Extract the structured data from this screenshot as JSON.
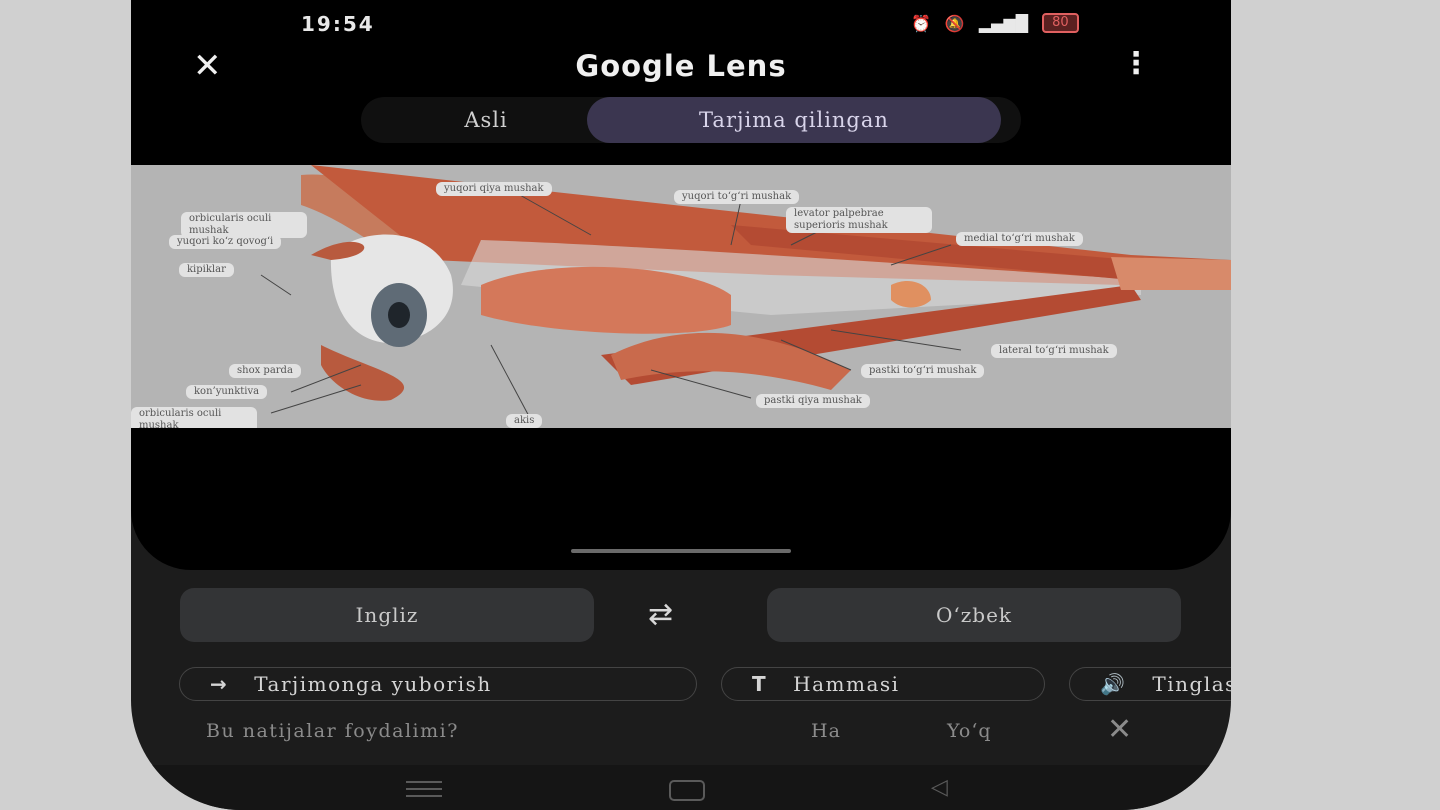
{
  "status_bar": {
    "time": "19:54",
    "battery": "80"
  },
  "app_bar": {
    "title": "Google Lens"
  },
  "tabs": {
    "original": "Asli",
    "translated": "Tarjima qilingan"
  },
  "diagram_labels": [
    "yuqori qiya mushak",
    "yuqori to‘g‘ri mushak",
    "levator palpebrae superioris mushak",
    "orbicularis oculi mushak",
    "yuqori ko‘z qovog‘i",
    "kipiklar",
    "medial to‘g‘ri mushak",
    "lateral to‘g‘ri mushak",
    "pastki to‘g‘ri mushak",
    "shox parda",
    "kon’yunktiva",
    "orbicularis oculi mushak",
    "pastki qiya mushak",
    "akis"
  ],
  "languages": {
    "source": "Ingliz",
    "target": "O‘zbek"
  },
  "chips": {
    "send": "Tarjimonga yuborish",
    "all": "Hammasi",
    "listen": "Tinglash"
  },
  "feedback": {
    "question": "Bu natijalar foydalimi?",
    "yes": "Ha",
    "no": "Yo‘q"
  }
}
